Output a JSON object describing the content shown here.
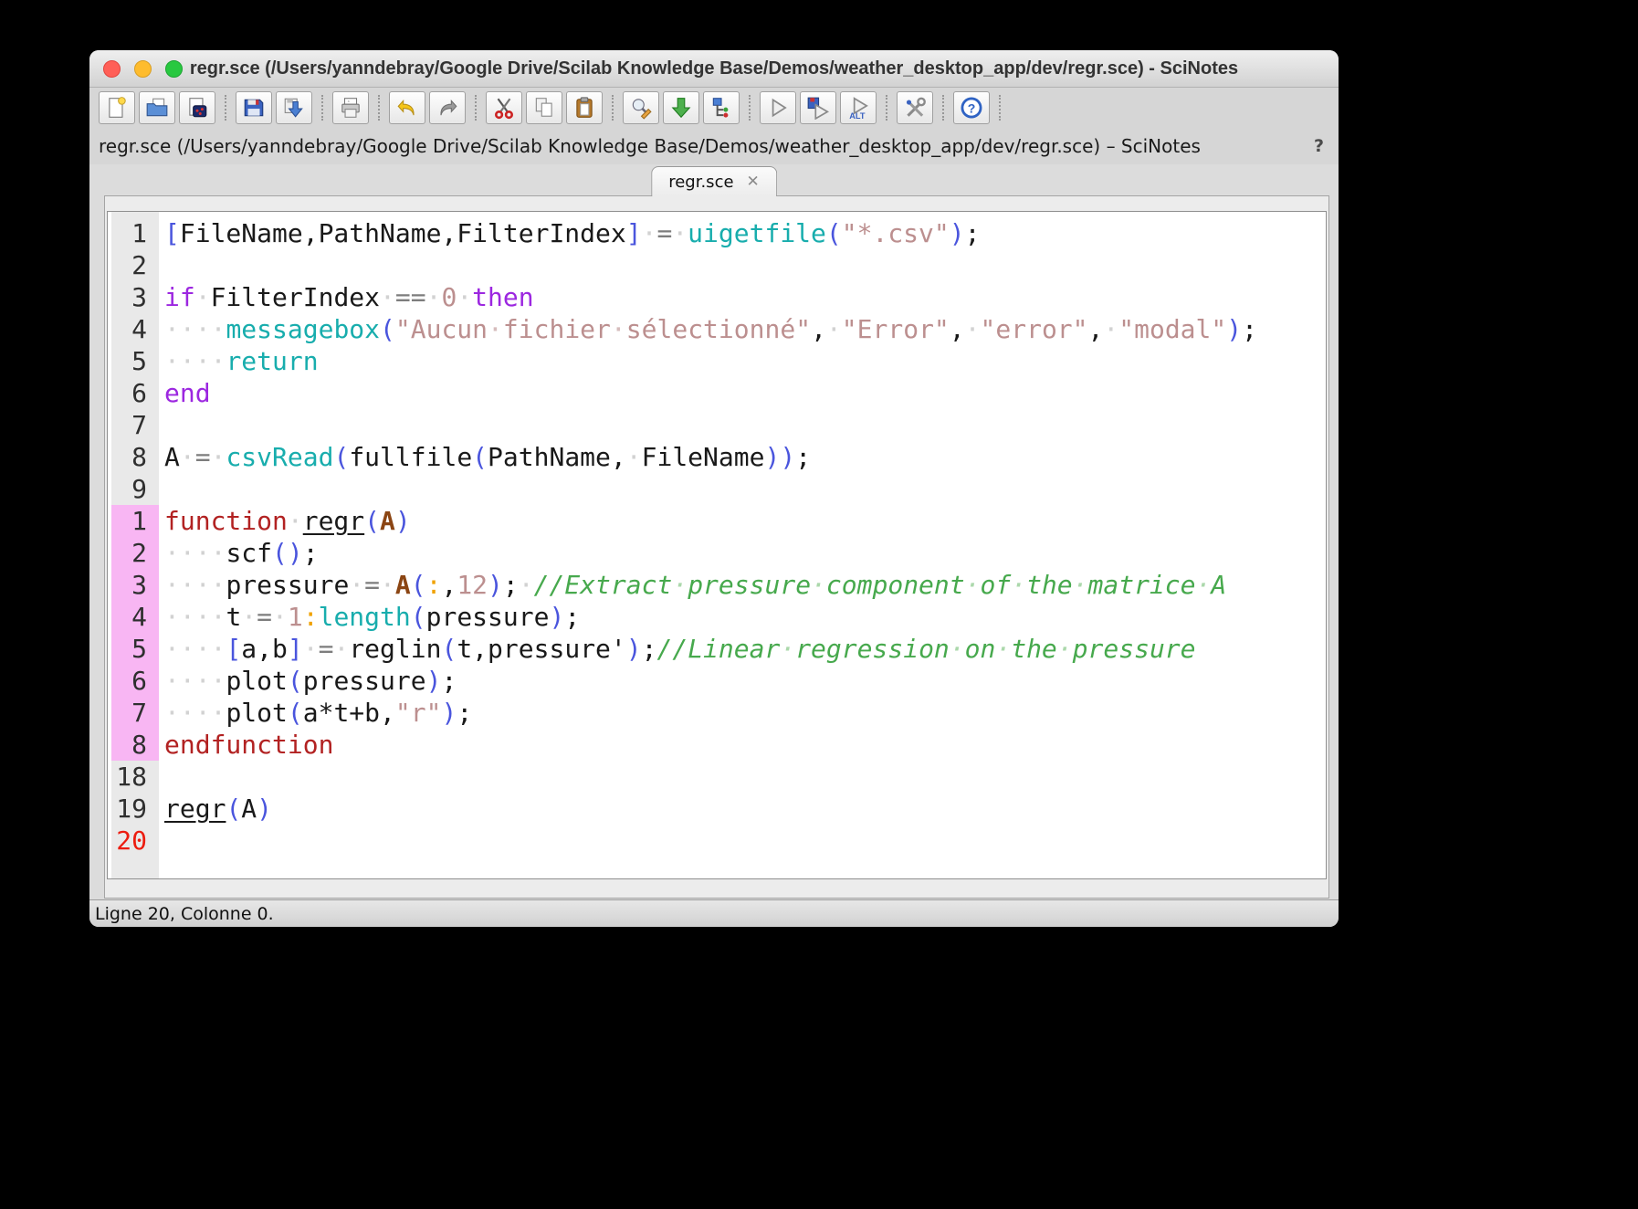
{
  "window": {
    "title": "regr.sce (/Users/yanndebray/Google Drive/Scilab Knowledge Base/Demos/weather_desktop_app/dev/regr.sce) - SciNotes",
    "traffic_lights": [
      "close",
      "minimize",
      "zoom"
    ]
  },
  "toolbar": {
    "groups": [
      [
        "new-file",
        "open-file",
        "open-source-file"
      ],
      [
        "save",
        "save-as"
      ],
      [
        "print"
      ],
      [
        "undo",
        "redo"
      ],
      [
        "cut",
        "copy",
        "paste"
      ],
      [
        "find-replace",
        "load-into-scilab",
        "code-navigator"
      ],
      [
        "execute",
        "save-and-execute",
        "execute-until-caret"
      ],
      [
        "preferences"
      ],
      [
        "help"
      ]
    ]
  },
  "path_bar": {
    "text": "regr.sce (/Users/yanndebray/Google Drive/Scilab Knowledge Base/Demos/weather_desktop_app/dev/regr.sce) – SciNotes",
    "help_label": "?"
  },
  "tab": {
    "label": "regr.sce",
    "close_glyph": "✕"
  },
  "status_bar": {
    "text": "Ligne 20, Colonne 0."
  },
  "colors": {
    "kw": "#9c27e0",
    "fn": "#18adad",
    "def": "#b22222",
    "arg": "#8b4513",
    "const": "#bc8f8f",
    "paren": "#4a55dd",
    "op": "#7d7d7d",
    "colon": "#f0a200",
    "comment": "#47a94d",
    "gutter_hl": "#f8b6f3",
    "current_line_num": "#ec1c0f"
  },
  "editor": {
    "lines": [
      {
        "num": "1",
        "tokens": [
          [
            "par",
            "["
          ],
          [
            "id",
            "FileName,PathName,FilterIndex"
          ],
          [
            "par",
            "]"
          ],
          [
            "ws",
            "·"
          ],
          [
            "op",
            "="
          ],
          [
            "ws",
            "·"
          ],
          [
            "fn",
            "uigetfile"
          ],
          [
            "par",
            "("
          ],
          [
            "str",
            "\"*.csv\""
          ],
          [
            "par",
            ")"
          ],
          [
            "id",
            ";"
          ]
        ]
      },
      {
        "num": "2",
        "tokens": []
      },
      {
        "num": "3",
        "tokens": [
          [
            "kw",
            "if"
          ],
          [
            "ws",
            "·"
          ],
          [
            "id",
            "FilterIndex"
          ],
          [
            "ws",
            "·"
          ],
          [
            "op",
            "=="
          ],
          [
            "ws",
            "·"
          ],
          [
            "num",
            "0"
          ],
          [
            "ws",
            "·"
          ],
          [
            "kw",
            "then"
          ]
        ]
      },
      {
        "num": "4",
        "tokens": [
          [
            "ws",
            "····"
          ],
          [
            "fn",
            "messagebox"
          ],
          [
            "par",
            "("
          ],
          [
            "str",
            "\"Aucun"
          ],
          [
            "sws",
            "·"
          ],
          [
            "str",
            "fichier"
          ],
          [
            "sws",
            "·"
          ],
          [
            "str",
            "sélectionné\""
          ],
          [
            "id",
            ","
          ],
          [
            "ws",
            "·"
          ],
          [
            "str",
            "\"Error\""
          ],
          [
            "id",
            ","
          ],
          [
            "ws",
            "·"
          ],
          [
            "str",
            "\"error\""
          ],
          [
            "id",
            ","
          ],
          [
            "ws",
            "·"
          ],
          [
            "str",
            "\"modal\""
          ],
          [
            "par",
            ")"
          ],
          [
            "id",
            ";"
          ]
        ]
      },
      {
        "num": "5",
        "tokens": [
          [
            "ws",
            "····"
          ],
          [
            "fn",
            "return"
          ]
        ]
      },
      {
        "num": "6",
        "tokens": [
          [
            "kw",
            "end"
          ]
        ]
      },
      {
        "num": "7",
        "tokens": []
      },
      {
        "num": "8",
        "tokens": [
          [
            "id",
            "A"
          ],
          [
            "ws",
            "·"
          ],
          [
            "op",
            "="
          ],
          [
            "ws",
            "·"
          ],
          [
            "fn",
            "csvRead"
          ],
          [
            "par",
            "("
          ],
          [
            "id",
            "fullfile"
          ],
          [
            "par",
            "("
          ],
          [
            "id",
            "PathName,"
          ],
          [
            "ws",
            "·"
          ],
          [
            "id",
            "FileName"
          ],
          [
            "par",
            "))"
          ],
          [
            "id",
            ";"
          ]
        ]
      },
      {
        "num": "9",
        "tokens": []
      },
      {
        "num": "1",
        "hl": true,
        "tokens": [
          [
            "def",
            "function"
          ],
          [
            "ws",
            "·"
          ],
          [
            "fname",
            "regr"
          ],
          [
            "par",
            "("
          ],
          [
            "arg",
            "A"
          ],
          [
            "par",
            ")"
          ]
        ]
      },
      {
        "num": "2",
        "hl": true,
        "tokens": [
          [
            "ws",
            "····"
          ],
          [
            "id",
            "scf"
          ],
          [
            "par",
            "()"
          ],
          [
            "id",
            ";"
          ]
        ]
      },
      {
        "num": "3",
        "hl": true,
        "tokens": [
          [
            "ws",
            "····"
          ],
          [
            "id",
            "pressure"
          ],
          [
            "ws",
            "·"
          ],
          [
            "op",
            "="
          ],
          [
            "ws",
            "·"
          ],
          [
            "arg",
            "A"
          ],
          [
            "par",
            "("
          ],
          [
            "colon",
            ":"
          ],
          [
            "id",
            ","
          ],
          [
            "num",
            "12"
          ],
          [
            "par",
            ")"
          ],
          [
            "id",
            ";"
          ],
          [
            "ws",
            "·"
          ],
          [
            "cmt",
            "//Extract"
          ],
          [
            "cws",
            "·"
          ],
          [
            "cmt",
            "pressure"
          ],
          [
            "cws",
            "·"
          ],
          [
            "cmt",
            "component"
          ],
          [
            "cws",
            "·"
          ],
          [
            "cmt",
            "of"
          ],
          [
            "cws",
            "·"
          ],
          [
            "cmt",
            "the"
          ],
          [
            "cws",
            "·"
          ],
          [
            "cmt",
            "matrice"
          ],
          [
            "cws",
            "·"
          ],
          [
            "cmt",
            "A"
          ]
        ]
      },
      {
        "num": "4",
        "hl": true,
        "tokens": [
          [
            "ws",
            "····"
          ],
          [
            "id",
            "t"
          ],
          [
            "ws",
            "·"
          ],
          [
            "op",
            "="
          ],
          [
            "ws",
            "·"
          ],
          [
            "num",
            "1"
          ],
          [
            "colon",
            ":"
          ],
          [
            "fn",
            "length"
          ],
          [
            "par",
            "("
          ],
          [
            "id",
            "pressure"
          ],
          [
            "par",
            ")"
          ],
          [
            "id",
            ";"
          ]
        ]
      },
      {
        "num": "5",
        "hl": true,
        "tokens": [
          [
            "ws",
            "····"
          ],
          [
            "par",
            "["
          ],
          [
            "id",
            "a,b"
          ],
          [
            "par",
            "]"
          ],
          [
            "ws",
            "·"
          ],
          [
            "op",
            "="
          ],
          [
            "ws",
            "·"
          ],
          [
            "id",
            "reglin"
          ],
          [
            "par",
            "("
          ],
          [
            "id",
            "t,pressure'"
          ],
          [
            "par",
            ")"
          ],
          [
            "id",
            ";"
          ],
          [
            "cmt",
            "//Linear"
          ],
          [
            "cws",
            "·"
          ],
          [
            "cmt",
            "regression"
          ],
          [
            "cws",
            "·"
          ],
          [
            "cmt",
            "on"
          ],
          [
            "cws",
            "·"
          ],
          [
            "cmt",
            "the"
          ],
          [
            "cws",
            "·"
          ],
          [
            "cmt",
            "pressure"
          ]
        ]
      },
      {
        "num": "6",
        "hl": true,
        "tokens": [
          [
            "ws",
            "····"
          ],
          [
            "id",
            "plot"
          ],
          [
            "par",
            "("
          ],
          [
            "id",
            "pressure"
          ],
          [
            "par",
            ")"
          ],
          [
            "id",
            ";"
          ]
        ]
      },
      {
        "num": "7",
        "hl": true,
        "tokens": [
          [
            "ws",
            "····"
          ],
          [
            "id",
            "plot"
          ],
          [
            "par",
            "("
          ],
          [
            "id",
            "a*t+b,"
          ],
          [
            "str",
            "\"r\""
          ],
          [
            "par",
            ")"
          ],
          [
            "id",
            ";"
          ]
        ]
      },
      {
        "num": "8",
        "hl": true,
        "tokens": [
          [
            "def",
            "endfunction"
          ]
        ]
      },
      {
        "num": "18",
        "tokens": []
      },
      {
        "num": "19",
        "tokens": [
          [
            "fname",
            "regr"
          ],
          [
            "par",
            "("
          ],
          [
            "id",
            "A"
          ],
          [
            "par",
            ")"
          ]
        ]
      },
      {
        "num": "20",
        "cur": true,
        "tokens": []
      }
    ]
  }
}
